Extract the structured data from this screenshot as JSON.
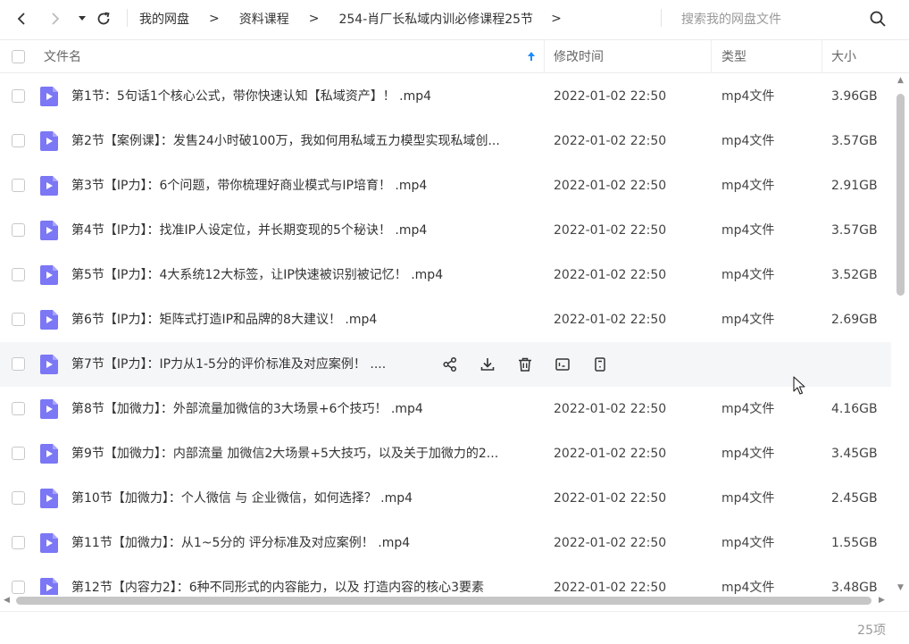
{
  "toolbar": {
    "breadcrumbs": [
      "我的网盘",
      "资料课程",
      "254-肖厂长私域内训必修课程25节"
    ],
    "separator": ">",
    "search_placeholder": "搜索我的网盘文件"
  },
  "columns": {
    "name": "文件名",
    "modified": "修改时间",
    "type": "类型",
    "size": "大小"
  },
  "files": [
    {
      "name": "第1节：5句话1个核心公式，带你快速认知【私域资产】！ .mp4",
      "modified": "2022-01-02 22:50",
      "type": "mp4文件",
      "size": "3.96GB"
    },
    {
      "name": "第2节【案例课】：发售24小时破100万，我如何用私域五力模型实现私域创...",
      "modified": "2022-01-02 22:50",
      "type": "mp4文件",
      "size": "3.57GB"
    },
    {
      "name": "第3节【IP力】：6个问题，带你梳理好商业模式与IP培育！ .mp4",
      "modified": "2022-01-02 22:50",
      "type": "mp4文件",
      "size": "2.91GB"
    },
    {
      "name": "第4节【IP力】：找准IP人设定位，并长期变现的5个秘诀！ .mp4",
      "modified": "2022-01-02 22:50",
      "type": "mp4文件",
      "size": "3.57GB"
    },
    {
      "name": "第5节【IP力】：4大系统12大标签，让IP快速被识别被记忆！ .mp4",
      "modified": "2022-01-02 22:50",
      "type": "mp4文件",
      "size": "3.52GB"
    },
    {
      "name": "第6节【IP力】：矩阵式打造IP和品牌的8大建议！ .mp4",
      "modified": "2022-01-02 22:50",
      "type": "mp4文件",
      "size": "2.69GB"
    },
    {
      "name": "第7节【IP力】：IP力从1-5分的评价标准及对应案例！ ....",
      "modified": "",
      "type": "",
      "size": ""
    },
    {
      "name": "第8节【加微力】：外部流量加微信的3大场景+6个技巧！ .mp4",
      "modified": "2022-01-02 22:50",
      "type": "mp4文件",
      "size": "4.16GB"
    },
    {
      "name": "第9节【加微力】：内部流量 加微信2大场景+5大技巧，以及关于加微力的2...",
      "modified": "2022-01-02 22:50",
      "type": "mp4文件",
      "size": "3.45GB"
    },
    {
      "name": "第10节【加微力】：个人微信 与 企业微信，如何选择？ .mp4",
      "modified": "2022-01-02 22:50",
      "type": "mp4文件",
      "size": "2.45GB"
    },
    {
      "name": "第11节【加微力】：从1~5分的 评分标准及对应案例！ .mp4",
      "modified": "2022-01-02 22:50",
      "type": "mp4文件",
      "size": "1.55GB"
    },
    {
      "name": "第12节【内容力2】：6种不同形式的内容能力，以及 打造内容的核心3要素",
      "modified": "2022-01-02 22:50",
      "type": "mp4文件",
      "size": "3.48GB"
    }
  ],
  "hovered_row_index": 6,
  "hover_actions": [
    "share-icon",
    "download-icon",
    "delete-icon",
    "rename-icon",
    "more-icon"
  ],
  "status": {
    "count": "25项"
  },
  "colors": {
    "file_icon": "#7b77f5",
    "hover_row": "#f5f6f8",
    "sort_arrow": "#1a8cff"
  }
}
